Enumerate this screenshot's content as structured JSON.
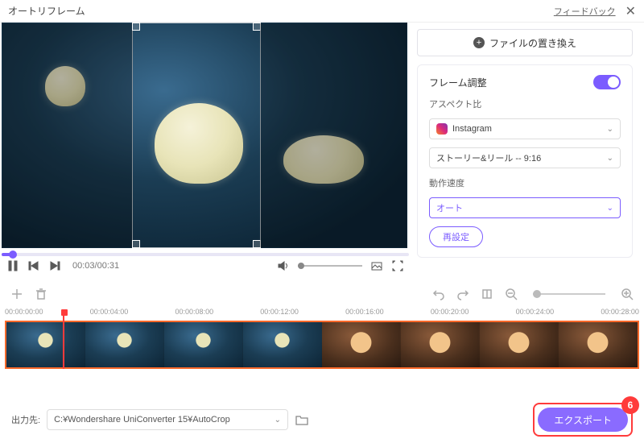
{
  "header": {
    "title": "オートリフレーム",
    "feedback": "フィードバック"
  },
  "playback": {
    "time": "00:03/00:31"
  },
  "side": {
    "replace_label": "ファイルの置き換え",
    "frame_adjust": "フレーム調整",
    "aspect_label": "アスペクト比",
    "aspect_value": "Instagram",
    "aspect_sub_value": "ストーリー&リール -- 9:16",
    "speed_label": "動作速度",
    "speed_value": "オート",
    "reset": "再設定"
  },
  "ruler": [
    "00:00:00:00",
    "00:00:04:00",
    "00:00:08:00",
    "00:00:12:00",
    "00:00:16:00",
    "00:00:20:00",
    "00:00:24:00",
    "00:00:28:00"
  ],
  "footer": {
    "out_label": "出力先:",
    "out_path": "C:¥Wondershare UniConverter 15¥AutoCrop",
    "export": "エクスポート",
    "badge": "6"
  }
}
